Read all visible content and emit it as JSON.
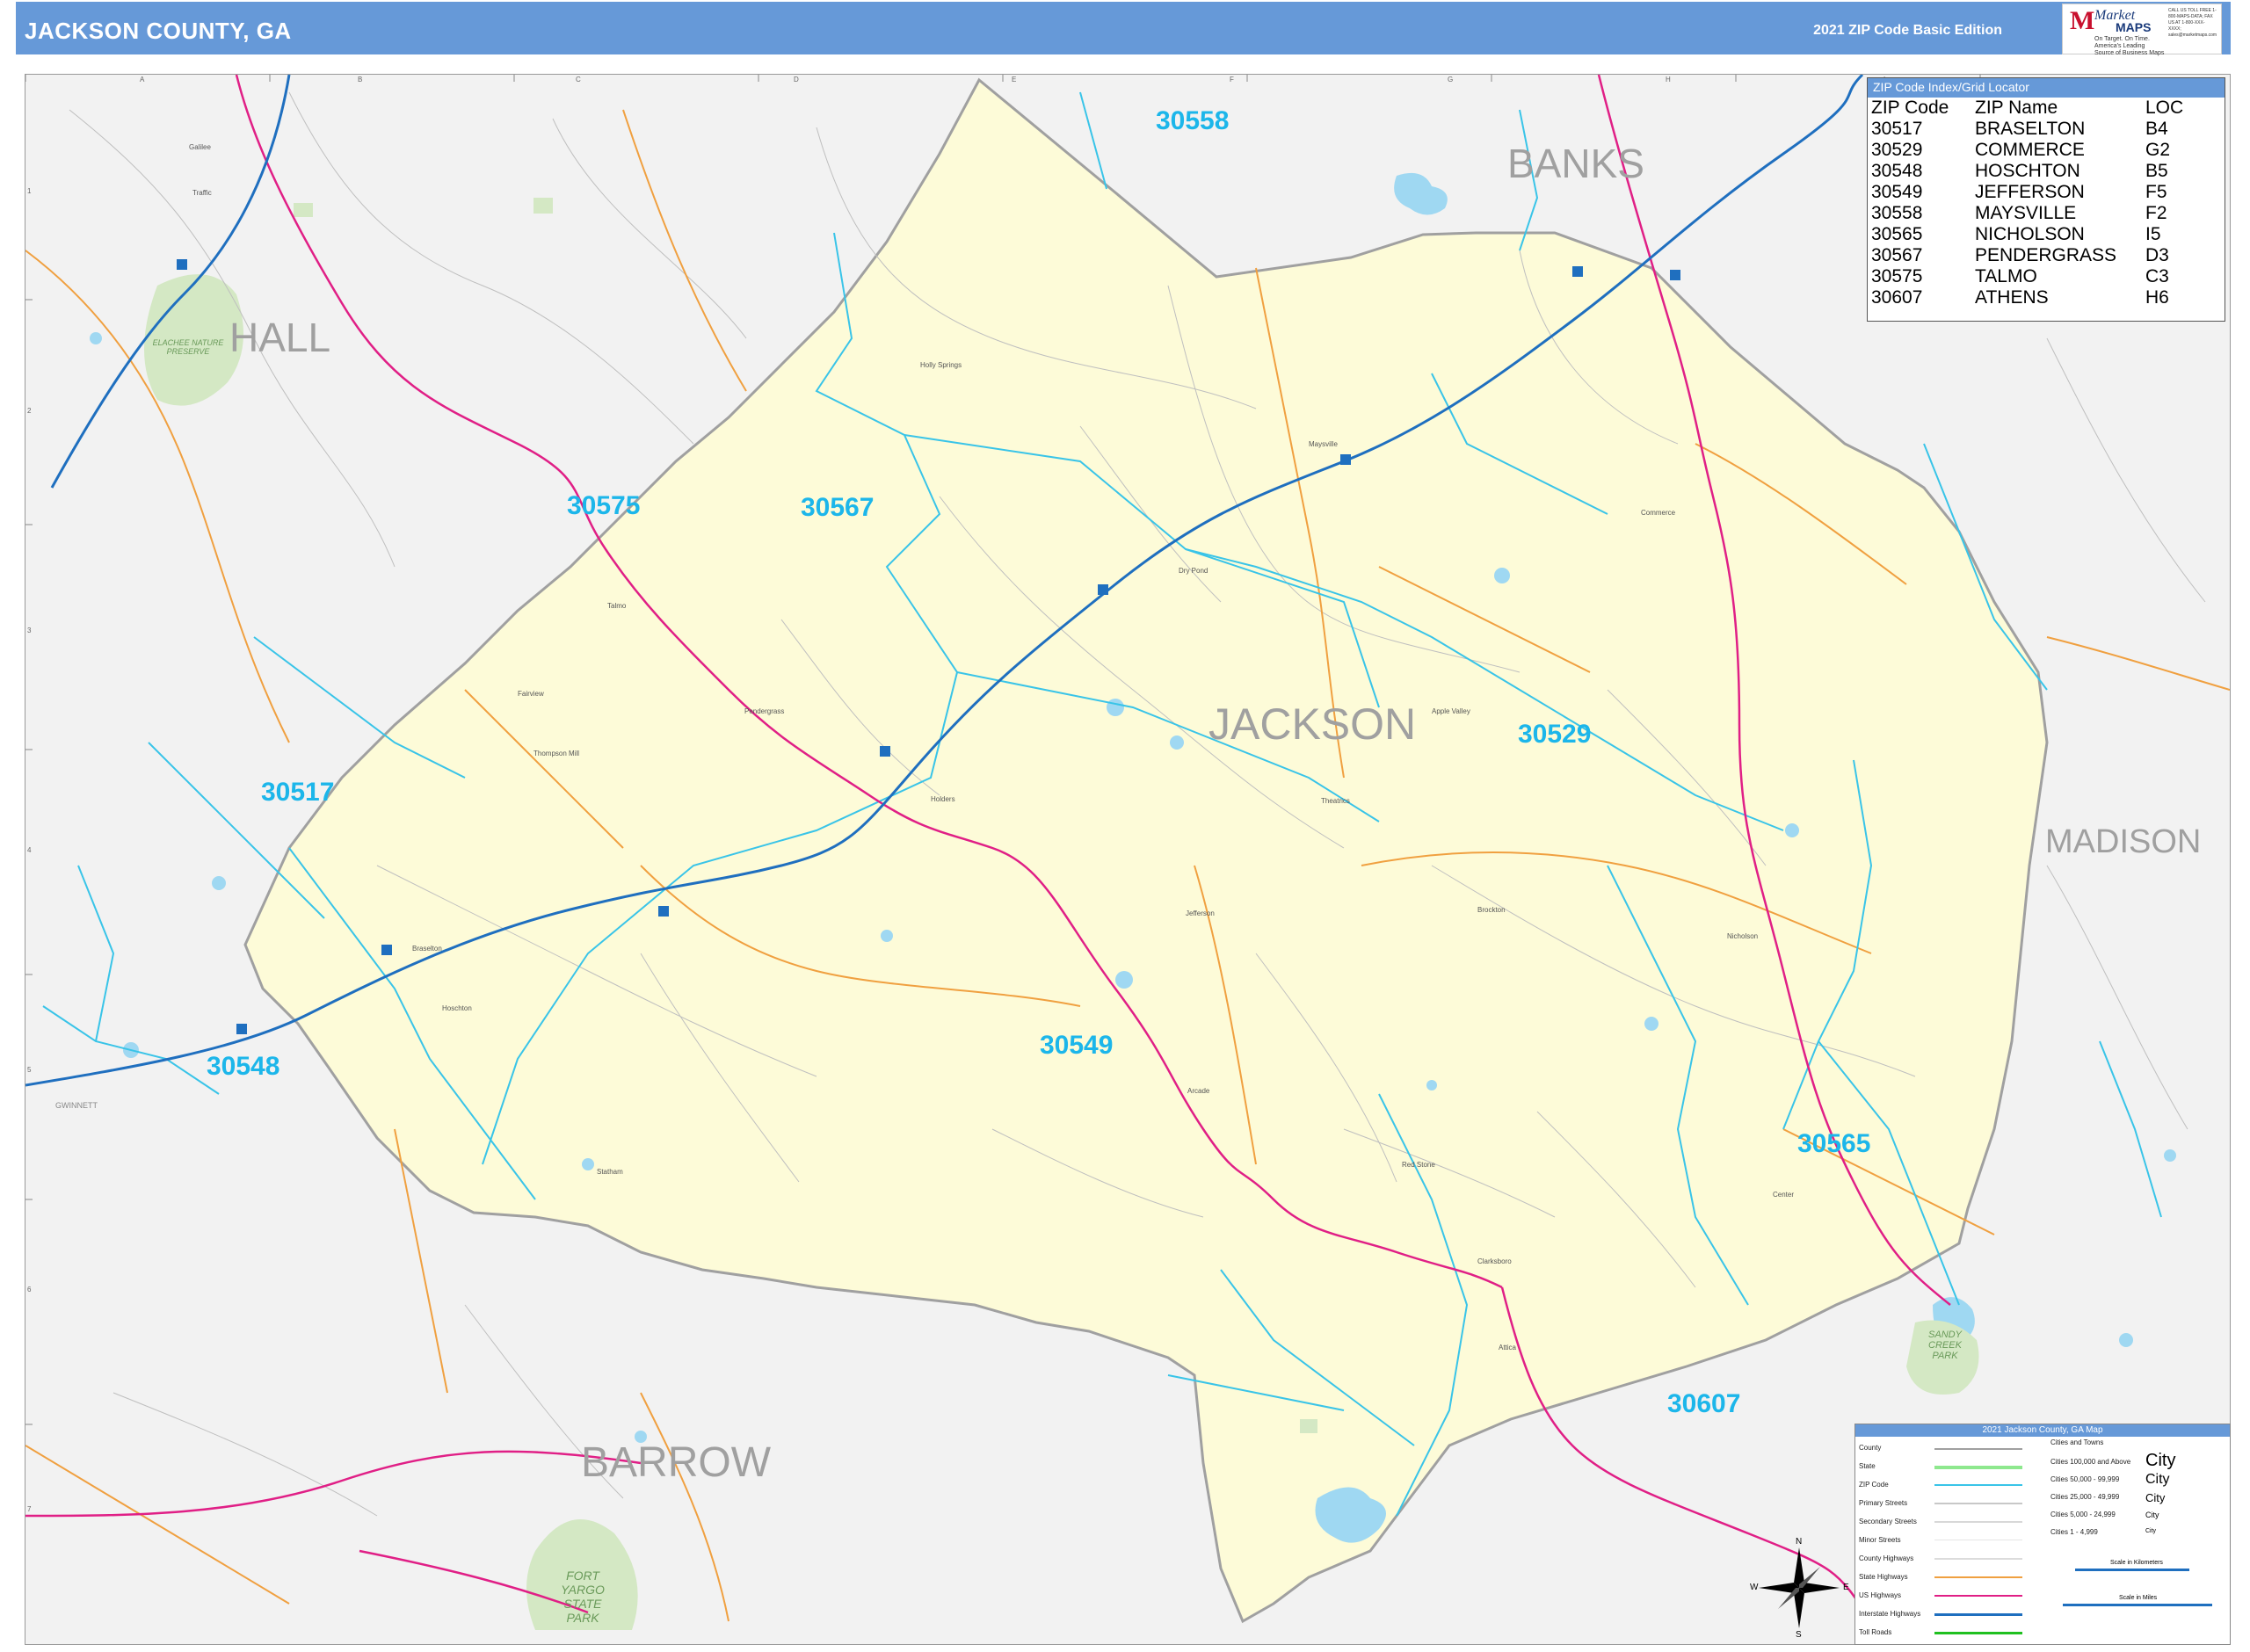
{
  "header": {
    "title": "JACKSON COUNTY, GA",
    "edition": "2021 ZIP Code Basic Edition",
    "logo_text": "Market",
    "logo_maps": "MAPS",
    "logo_tagline": "On Target. On Time. America's Leading Source of Business Maps",
    "logo_contact": "CALL US TOLL FREE 1-800-MAPS-DATA; FAX US AT 1-800-XXX-XXXX; sales@marketmaps.com"
  },
  "colors": {
    "header_bg": "#6699d8",
    "county_fill": "#fdfbd8",
    "outside_fill": "#f2f2f2",
    "zip_boundary": "#39c4e8",
    "interstate": "#1f6fbf",
    "us_highway": "#e01f86",
    "state_highway": "#f0a040",
    "county_boundary": "#a0a0a0",
    "zip_label": "#1cb6ea",
    "county_label": "#a0a0a0",
    "park_fill": "#d4e8c4",
    "water_fill": "#9fd8f2"
  },
  "grid": {
    "columns": [
      "A",
      "B",
      "C",
      "D",
      "E",
      "F",
      "G",
      "H",
      "I"
    ],
    "rows": [
      "1",
      "2",
      "3",
      "4",
      "5",
      "6",
      "7"
    ]
  },
  "counties": [
    {
      "name": "JACKSON"
    },
    {
      "name": "BANKS"
    },
    {
      "name": "HALL"
    },
    {
      "name": "MADISON"
    },
    {
      "name": "BARROW"
    },
    {
      "name": "GWINNETT"
    }
  ],
  "zip_labels": [
    "30558",
    "30575",
    "30567",
    "30517",
    "30529",
    "30548",
    "30549",
    "30565",
    "30607"
  ],
  "parks": [
    "ELACHEE NATURE PRESERVE",
    "FORT YARGO STATE PARK",
    "SANDY CREEK PARK"
  ],
  "places": [
    "Holly Springs",
    "Maysville",
    "Commerce",
    "Dry Pond",
    "Talmo",
    "Fairview",
    "Pendergrass",
    "Thompson Mill",
    "Jefferson",
    "Holders",
    "Theatrics",
    "Apple Valley",
    "Brockton",
    "Nicholson",
    "Braselton",
    "Hoschton",
    "Arcade",
    "Red Stone",
    "Center",
    "Clarksboro",
    "Attica",
    "Statham",
    "Galilee",
    "Traffic"
  ],
  "zip_index": {
    "title": "ZIP Code Index/Grid Locator",
    "columns": [
      "ZIP Code",
      "ZIP Name",
      "LOC"
    ],
    "rows": [
      [
        "30517",
        "BRASELTON",
        "B4"
      ],
      [
        "30529",
        "COMMERCE",
        "G2"
      ],
      [
        "30548",
        "HOSCHTON",
        "B5"
      ],
      [
        "30549",
        "JEFFERSON",
        "F5"
      ],
      [
        "30558",
        "MAYSVILLE",
        "F2"
      ],
      [
        "30565",
        "NICHOLSON",
        "I5"
      ],
      [
        "30567",
        "PENDERGRASS",
        "D3"
      ],
      [
        "30575",
        "TALMO",
        "C3"
      ],
      [
        "30607",
        "ATHENS",
        "H6"
      ]
    ]
  },
  "legend": {
    "title": "2021 Jackson County, GA Map",
    "items": [
      "County",
      "State",
      "ZIP Code",
      "Primary Streets",
      "Secondary Streets",
      "Minor Streets",
      "County Highways",
      "State Highways",
      "US Highways",
      "Interstate Highways",
      "Toll Roads"
    ],
    "cities_title": "Cities and Towns",
    "city_classes": [
      "Cities 100,000 and Above",
      "Cities 50,000 - 99,999",
      "Cities 25,000 - 49,999",
      "Cities 5,000 - 24,999",
      "Cities 1 - 4,999"
    ],
    "city_example": "City",
    "scale_km": "Scale in Kilometers",
    "scale_mi": "Scale in Miles",
    "compass": [
      "N",
      "S",
      "E",
      "W"
    ]
  }
}
